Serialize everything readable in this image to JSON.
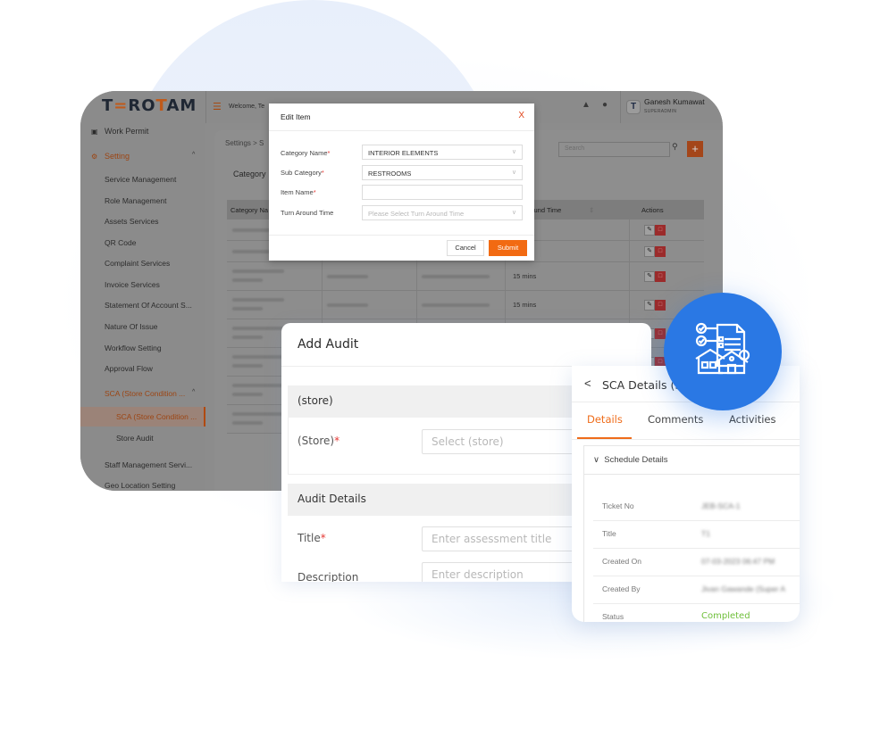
{
  "app": {
    "logo": "TEROTAM",
    "welcome": "Welcome, Te",
    "user": {
      "name": "Ganesh Kumawat",
      "role": "SUPERADMIN",
      "avatar_letter": "T"
    },
    "breadcrumb": "Settings  >  S",
    "page_label": "Category",
    "search_placeholder": "Search",
    "add_label": "+",
    "sidebar": [
      {
        "label": "Work Permit",
        "icon": "clipboard-icon",
        "level": "top"
      },
      {
        "label": "Setting",
        "icon": "gears-icon",
        "level": "top",
        "active": true,
        "expanded": true
      },
      {
        "label": "Service Management",
        "level": "sub"
      },
      {
        "label": "Role Management",
        "level": "sub"
      },
      {
        "label": "Assets Services",
        "level": "sub"
      },
      {
        "label": "QR Code",
        "level": "sub"
      },
      {
        "label": "Complaint Services",
        "level": "sub"
      },
      {
        "label": "Invoice Services",
        "level": "sub"
      },
      {
        "label": "Statement Of Account S...",
        "level": "sub"
      },
      {
        "label": "Nature Of Issue",
        "level": "sub"
      },
      {
        "label": "Workflow Setting",
        "level": "sub"
      },
      {
        "label": "Approval Flow",
        "level": "sub"
      },
      {
        "label": "SCA (Store Condition ...",
        "level": "sub",
        "active": true,
        "expanded": true
      },
      {
        "label": "SCA (Store Condition ...",
        "level": "subsub",
        "selected": true
      },
      {
        "label": "Store Audit",
        "level": "subsub"
      },
      {
        "label": "Staff Management Servi...",
        "level": "sub"
      },
      {
        "label": "Geo Location Setting",
        "level": "sub"
      }
    ],
    "table": {
      "headers": [
        "Category Na",
        "",
        "",
        "Turn Around Time",
        "Actions"
      ],
      "rows": [
        {
          "turn_around": ""
        },
        {
          "turn_around": ""
        },
        {
          "turn_around": "15 mins"
        },
        {
          "turn_around": "15 mins"
        },
        {
          "turn_around": ""
        },
        {
          "turn_around": ""
        },
        {
          "turn_around": ""
        },
        {
          "turn_around": ""
        }
      ]
    }
  },
  "edit_modal": {
    "title": "Edit Item",
    "close": "X",
    "fields": [
      {
        "label": "Category Name",
        "required": "*",
        "value": "INTERIOR ELEMENTS",
        "type": "select"
      },
      {
        "label": "Sub Category",
        "required": "*",
        "value": "RESTROOMS",
        "type": "select"
      },
      {
        "label": "Item Name",
        "required": "*",
        "value": "",
        "type": "text"
      },
      {
        "label": "Turn Around Time",
        "required": "",
        "placeholder": "Please Select Turn Around Time",
        "type": "select"
      }
    ],
    "cancel": "Cancel",
    "submit": "Submit"
  },
  "add_audit": {
    "title": "Add Audit",
    "sections": [
      {
        "heading": "(store)",
        "field_label": "(Store)",
        "required": "*",
        "placeholder": "Select (store)"
      },
      {
        "heading": "Audit Details"
      }
    ],
    "title_label": "Title",
    "title_required": "*",
    "title_placeholder": "Enter assessment title",
    "description_label": "Description",
    "description_placeholder": "Enter description"
  },
  "sca_details": {
    "back": "<",
    "title": "SCA Details (S",
    "tabs": [
      "Details",
      "Comments",
      "Activities"
    ],
    "active_tab": "Details",
    "accordion": "Schedule Details",
    "rows": [
      {
        "label": "Ticket No",
        "value": "JEB-SCA-1"
      },
      {
        "label": "Title",
        "value": "T1"
      },
      {
        "label": "Created On",
        "value": "07-03-2023 06:47 PM"
      },
      {
        "label": "Created By",
        "value": "Jivan Gawande (Super A"
      },
      {
        "label": "Status",
        "value": "Completed"
      }
    ],
    "status_color": "#6fbf3a"
  },
  "colors": {
    "accent": "#f26a12",
    "brand_blue": "#2a78e4",
    "danger": "#e53935"
  },
  "feature_icon": "audit-checklist-houses-icon"
}
